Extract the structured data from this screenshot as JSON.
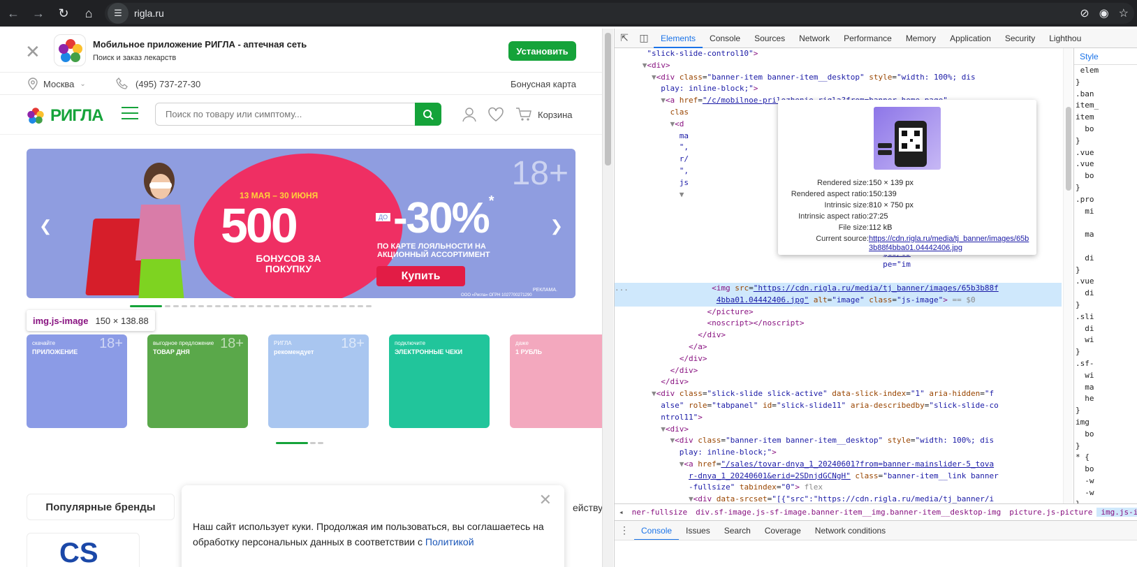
{
  "browser": {
    "url": "rigla.ru"
  },
  "app_banner": {
    "title": "Мобильное приложение РИГЛА - аптечная сеть",
    "subtitle": "Поиск и заказ лекарств",
    "install_label": "Установить"
  },
  "topline": {
    "city": "Москва",
    "phone": "(495) 737-27-30",
    "bonus_card": "Бонусная карта"
  },
  "header": {
    "logo": "РИГЛА",
    "search_placeholder": "Поиск по товару или симптому...",
    "cart_label": "Корзина"
  },
  "main_banner": {
    "age": "18+",
    "date": "13 МАЯ – 30 ИЮНЯ",
    "big_number": "500",
    "bonus_text": "БОНУСОВ ЗА ПОКУПКУ",
    "do_label": "ДО",
    "discount": "-30%",
    "discount_mark": "*",
    "loyalty_text": "ПО КАРТЕ ЛОЯЛЬНОСТИ НА АКЦИОННЫЙ АССОРТИМЕНТ",
    "buy_label": "Купить",
    "ad_label": "РЕКЛАМА.",
    "legal": "ООО «Ригла» ОГРН 1027700271290"
  },
  "element_tooltip": {
    "selector": "img.js-image",
    "size": "150 × 138.88"
  },
  "tiles": [
    {
      "line1": "скачайте",
      "line2": "ПРИЛОЖЕНИЕ",
      "age": "18+",
      "color": "#8b9be6"
    },
    {
      "line1": "выгодное предложение",
      "line2": "ТОВАР ДНЯ",
      "age": "18+",
      "color": "#5aa84a"
    },
    {
      "line1": "РИГЛА",
      "line2": "рекомендует",
      "age": "18+",
      "color": "#a9c6f0"
    },
    {
      "line1": "подключите",
      "line2": "ЭЛЕКТРОННЫЕ ЧЕКИ",
      "age": "",
      "color": "#21c59b"
    },
    {
      "line1": "даже",
      "line2": "1 РУБЛЬ",
      "age": "",
      "color": "#f3a8be"
    }
  ],
  "brands": {
    "popular_label": "Популярные бренды",
    "right_text": "ействую",
    "brand_logo_text": "CS"
  },
  "cookie": {
    "text": "Наш сайт использует куки. Продолжая им пользоваться, вы соглашаетесь на обработку персональных данных в соответствии с",
    "link": "Политикой"
  },
  "devtools": {
    "tabs": [
      "Elements",
      "Console",
      "Sources",
      "Network",
      "Performance",
      "Memory",
      "Application",
      "Security",
      "Lighthou"
    ],
    "active_tab": "Elements",
    "image_tooltip": {
      "rendered_size_k": "Rendered size:",
      "rendered_size_v": "150 × 139 px",
      "rendered_ratio_k": "Rendered aspect ratio:",
      "rendered_ratio_v": "150:139",
      "intrinsic_size_k": "Intrinsic size:",
      "intrinsic_size_v": "810 × 750 px",
      "intrinsic_ratio_k": "Intrinsic aspect ratio:",
      "intrinsic_ratio_v": "27:25",
      "file_size_k": "File size:",
      "file_size_v": "112 kB",
      "source_k": "Current source:",
      "source_v": "https://cdn.rigla.ru/media/tj_banner/images/65b3b88f4bba01.04442406.jpg"
    },
    "breadcrumb": [
      "ner-fullsize",
      "div.sf-image.js-sf-image.banner-item__img.banner-item__desktop-img",
      "picture.js-picture",
      "img.js-image"
    ],
    "drawer_tabs": [
      "Console",
      "Issues",
      "Search",
      "Coverage",
      "Network conditions"
    ],
    "styles_label": "Style"
  }
}
